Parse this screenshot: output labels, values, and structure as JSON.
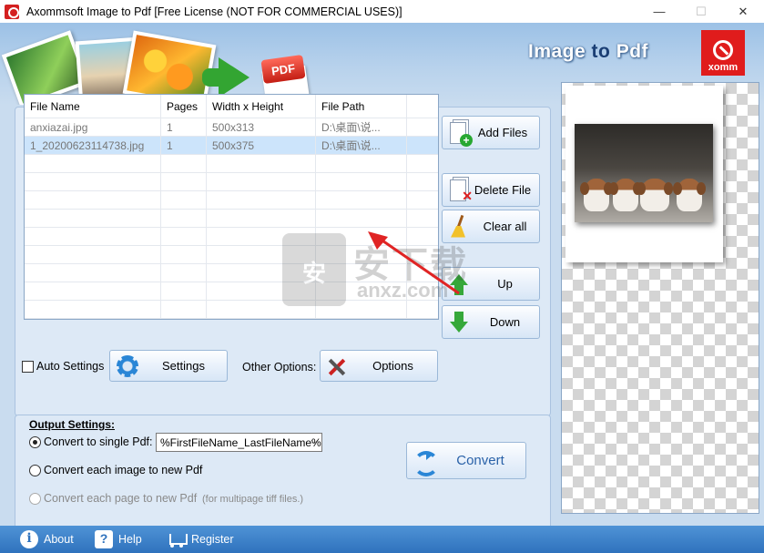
{
  "window": {
    "title": "Axommsoft Image to Pdf [Free License (NOT FOR COMMERCIAL USES)]",
    "minimize": "—",
    "maximize": "☐",
    "close": "✕"
  },
  "banner": {
    "brand_image": "Image ",
    "brand_to": "to",
    "brand_pdf": " Pdf",
    "pdf_badge": "PDF",
    "logo_text": "xomm"
  },
  "file_list": {
    "columns": [
      "File Name",
      "Pages",
      "Width x Height",
      "File Path"
    ],
    "rows": [
      {
        "name": "anxiazai.jpg",
        "pages": "1",
        "size": "500x313",
        "path": "D:\\桌面\\说..."
      },
      {
        "name": "1_20200623114738.jpg",
        "pages": "1",
        "size": "500x375",
        "path": "D:\\桌面\\说..."
      }
    ],
    "selected_index": 1
  },
  "buttons": {
    "add_files": "Add Files",
    "delete_file": "Delete File",
    "clear_all": "Clear all",
    "up": "Up",
    "down": "Down",
    "settings": "Settings",
    "options": "Options",
    "convert": "Convert"
  },
  "settings_row": {
    "auto_settings": "Auto Settings",
    "auto_settings_checked": false,
    "other_options": "Other Options:"
  },
  "output": {
    "title": "Output Settings:",
    "single_pdf": "Convert to single Pdf:",
    "single_pdf_selected": true,
    "filename_pattern": "%FirstFileName_LastFileName%",
    "each_image": "Convert each image to new Pdf",
    "each_page": "Convert each page to new Pdf",
    "each_page_note": "(for multipage tiff files.)"
  },
  "bottom": {
    "about": "About",
    "help": "Help",
    "register": "Register"
  },
  "watermark": {
    "big": "安下载",
    "site": "anxz.com"
  },
  "colors": {
    "background": "#c9dcef",
    "panel": "#dde9f6",
    "bottom_bar": "#2f72bd",
    "selection": "#cce4fb",
    "annotation_arrow": "#e02424"
  }
}
